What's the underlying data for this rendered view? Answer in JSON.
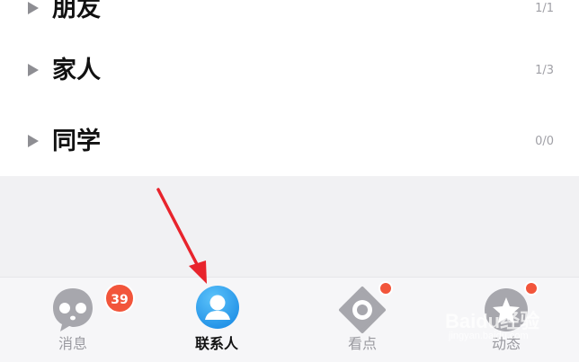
{
  "groups": [
    {
      "name": "朋友",
      "count": "1/1"
    },
    {
      "name": "家人",
      "count": "1/3"
    },
    {
      "name": "同学",
      "count": "0/0"
    }
  ],
  "tabbar": {
    "messages": {
      "label": "消息",
      "badge": "39",
      "icon": "message-bubble-icon"
    },
    "contacts": {
      "label": "联系人",
      "icon": "contact-person-icon",
      "active": true
    },
    "watch": {
      "label": "看点",
      "icon": "eye-icon"
    },
    "moments": {
      "label": "动态",
      "icon": "star-feed-icon"
    }
  },
  "annotation": {
    "icon": "red-arrow-icon",
    "color": "#e8242c"
  },
  "watermark": {
    "brand": "Baidu经验",
    "url": "jingyan.baidu.com"
  },
  "colors": {
    "badge": "#f2553b",
    "active_icon": "#2e9cf0",
    "inactive_icon": "#a7a7ad"
  }
}
